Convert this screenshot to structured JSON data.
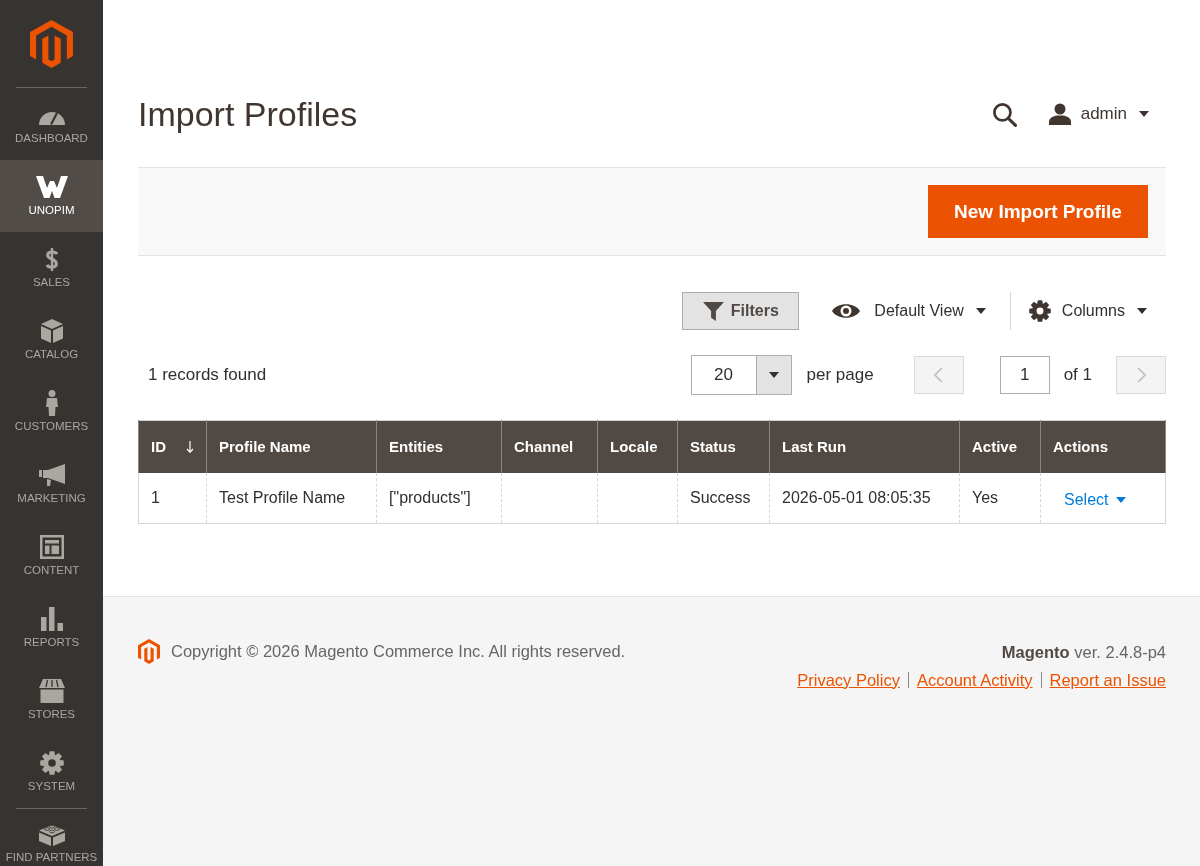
{
  "sidebar": {
    "items": [
      {
        "label": "DASHBOARD",
        "selected": false
      },
      {
        "label": "UNOPIM",
        "selected": true
      },
      {
        "label": "SALES",
        "selected": false
      },
      {
        "label": "CATALOG",
        "selected": false
      },
      {
        "label": "CUSTOMERS",
        "selected": false
      },
      {
        "label": "MARKETING",
        "selected": false
      },
      {
        "label": "CONTENT",
        "selected": false
      },
      {
        "label": "REPORTS",
        "selected": false
      },
      {
        "label": "STORES",
        "selected": false
      },
      {
        "label": "SYSTEM",
        "selected": false
      }
    ],
    "bottom_items": [
      {
        "label": "FIND PARTNERS",
        "selected": false
      }
    ]
  },
  "header": {
    "title": "Import Profiles",
    "user_name": "admin"
  },
  "page_actions": {
    "add_button": "New Import Profile"
  },
  "toolbar": {
    "filters_button": "Filters",
    "view_switcher": "Default View",
    "columns_button": "Columns"
  },
  "pager": {
    "records_found": "1 records found",
    "per_page_value": "20",
    "per_page_label": "per page",
    "previous": {
      "disabled": true
    },
    "page_value": "1",
    "page_total": "of 1",
    "next": {
      "disabled": true
    }
  },
  "table": {
    "columns": [
      {
        "label": "ID",
        "sorted": true
      },
      {
        "label": "Profile Name",
        "sorted": false
      },
      {
        "label": "Entities",
        "sorted": false
      },
      {
        "label": "Channel",
        "sorted": false
      },
      {
        "label": "Locale",
        "sorted": false
      },
      {
        "label": "Status",
        "sorted": false
      },
      {
        "label": "Last Run",
        "sorted": false
      },
      {
        "label": "Active",
        "sorted": false
      },
      {
        "label": "Actions",
        "sorted": false
      }
    ],
    "rows": [
      {
        "id": "1",
        "profile_name": "Test Profile Name",
        "entities": "[\"products\"]",
        "status": "Success",
        "last_run": "2026-05-01 08:05:35",
        "active": "Yes",
        "action": "Select"
      }
    ]
  },
  "footer": {
    "copyright": "Copyright © 2026 Magento Commerce Inc. All rights reserved.",
    "version": "**Magento** ver. 2.4.8-p4",
    "links": [
      "Privacy Policy",
      "Account Activity",
      "Report an Issue"
    ]
  }
}
